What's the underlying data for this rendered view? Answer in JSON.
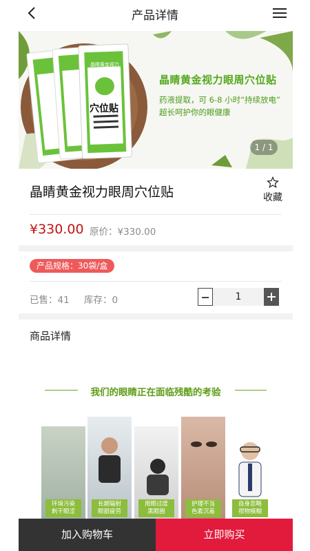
{
  "header": {
    "title": "产品详情",
    "back_icon": "chevron-left-icon",
    "menu_icon": "hamburger-menu-icon"
  },
  "banner": {
    "headline": "晶睛黄金视力眼周穴位贴",
    "line1": "药液提取，可 6-8 小时“持续放电”",
    "line2": "超长呵护你的眼健康",
    "packet_brand": "晶睛黄金视力",
    "packet_logo": "晶睛",
    "packet_label": "穴位贴",
    "counter": "1 / 1"
  },
  "product": {
    "name": "晶睛黄金视力眼周穴位贴",
    "favorite_label": "收藏",
    "favorite_icon": "star-outline-icon",
    "price": "¥330.00",
    "original_price": "原价：¥330.00",
    "spec": "产品规格：30袋/盒",
    "sold": "已售：41",
    "stock": "库存：0",
    "quantity": "1"
  },
  "detail": {
    "title": "商品详情",
    "image_headline": "我们的眼睛正在面临残酷的考验",
    "captions": [
      [
        "环境污染",
        "刺干眼涩"
      ],
      [
        "长期辐射",
        "眼部疲劳"
      ],
      [
        "用眼过度",
        "黑眼圈"
      ],
      [
        "护理不当",
        "色素沉着"
      ],
      [
        "自身忽略",
        "视物模糊"
      ]
    ]
  },
  "actions": {
    "add_to_cart": "加入购物车",
    "buy_now": "立即购买"
  },
  "colors": {
    "price": "#c01313",
    "spec_badge": "#ee5a5a",
    "buy": "#e21a3c",
    "cart": "#333333",
    "brand_green": "#54a81f"
  }
}
